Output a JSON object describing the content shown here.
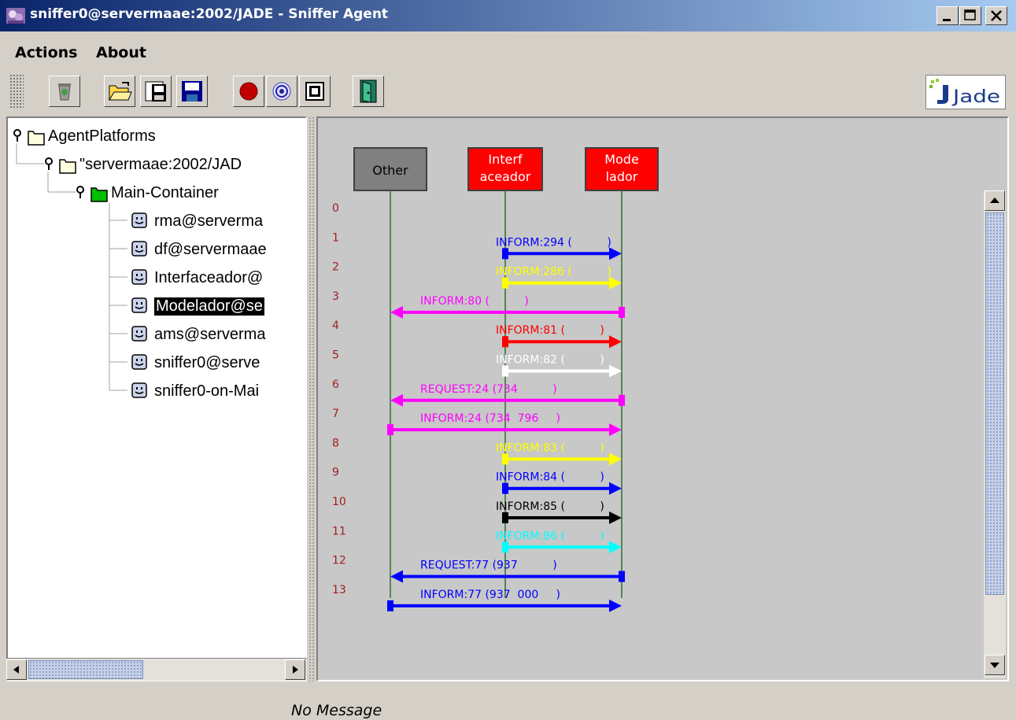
{
  "window": {
    "title": "sniffer0@servermaae:2002/JADE - Sniffer Agent"
  },
  "menu": [
    "Actions",
    "About"
  ],
  "toolbar": {
    "buttons": [
      "trash-icon",
      "open-folder-icon",
      "save-snapshot-icon",
      "save-icon",
      "record-icon",
      "sniff-icon",
      "stop-icon",
      "exit-door-icon"
    ],
    "logo_text": "Jade"
  },
  "tree": {
    "items": [
      {
        "label": "AgentPlatforms",
        "type": "folder"
      },
      {
        "label": "\"servermaae:2002/JAD",
        "type": "folder"
      },
      {
        "label": "Main-Container",
        "type": "container"
      },
      {
        "label": "rma@serverma",
        "type": "agent"
      },
      {
        "label": "df@servermaae",
        "type": "agent"
      },
      {
        "label": "Interfaceador@",
        "type": "agent"
      },
      {
        "label": "Modelador@se",
        "type": "agent",
        "selected": true
      },
      {
        "label": "ams@serverma",
        "type": "agent"
      },
      {
        "label": "sniffer0@serve",
        "type": "agent"
      },
      {
        "label": "sniffer0-on-Mai",
        "type": "agent"
      }
    ]
  },
  "sniffer": {
    "agents": [
      {
        "line1": "Other",
        "line2": "",
        "color": "#808080",
        "textcolor": "#000000"
      },
      {
        "line1": "Interf",
        "line2": "aceador",
        "color": "#ff0000",
        "textcolor": "#ffffff"
      },
      {
        "line1": "Mode",
        "line2": "lador",
        "color": "#ff0000",
        "textcolor": "#ffffff"
      }
    ],
    "messages": [
      {
        "num": "0",
        "label": "",
        "from": -1,
        "to": -1,
        "color": "#000000"
      },
      {
        "num": "1",
        "label": "INFORM:294 (          )",
        "from": 1,
        "to": 2,
        "color": "#0000ff"
      },
      {
        "num": "2",
        "label": "INFORM:286 (          )",
        "from": 1,
        "to": 2,
        "color": "#ffff00"
      },
      {
        "num": "3",
        "label": "INFORM:80 (          )",
        "from": 2,
        "to": 0,
        "color": "#ff00ff"
      },
      {
        "num": "4",
        "label": "INFORM:81 (          )",
        "from": 1,
        "to": 2,
        "color": "#ff0000"
      },
      {
        "num": "5",
        "label": "INFORM:82 (          )",
        "from": 1,
        "to": 2,
        "color": "#ffffff"
      },
      {
        "num": "6",
        "label": "REQUEST:24 (734          )",
        "from": 2,
        "to": 0,
        "color": "#ff00ff"
      },
      {
        "num": "7",
        "label": "INFORM:24 (734  796     )",
        "from": 0,
        "to": 2,
        "color": "#ff00ff"
      },
      {
        "num": "8",
        "label": "INFORM:83 (          )",
        "from": 1,
        "to": 2,
        "color": "#ffff00"
      },
      {
        "num": "9",
        "label": "INFORM:84 (          )",
        "from": 1,
        "to": 2,
        "color": "#0000ff"
      },
      {
        "num": "10",
        "label": "INFORM:85 (          )",
        "from": 1,
        "to": 2,
        "color": "#000000"
      },
      {
        "num": "11",
        "label": "INFORM:86 (          )",
        "from": 1,
        "to": 2,
        "color": "#00ffff"
      },
      {
        "num": "12",
        "label": "REQUEST:77 (937          )",
        "from": 2,
        "to": 0,
        "color": "#0000ff"
      },
      {
        "num": "13",
        "label": "INFORM:77 (937  000     )",
        "from": 0,
        "to": 2,
        "color": "#0000ff"
      }
    ]
  },
  "status": {
    "text": "No Message"
  }
}
